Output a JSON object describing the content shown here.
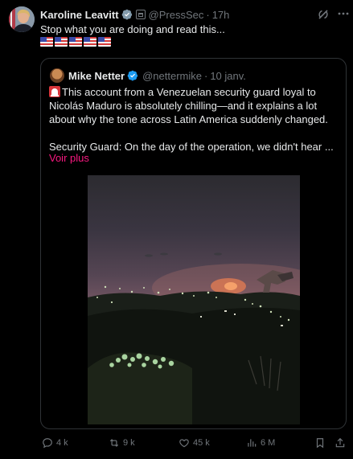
{
  "post": {
    "author_name": "Karoline Leavitt",
    "handle": "@PressSec",
    "separator": "·",
    "time": "17h",
    "text": "Stop what you are doing and read this...",
    "flags_count": 5
  },
  "quoted_post": {
    "author_name": "Mike Netter",
    "handle": "@nettermike",
    "separator": "·",
    "time": "10 janv.",
    "line1": "This account from a Venezuelan security guard loyal to",
    "line2": "Nicolás Maduro is absolutely chilling—and it explains a lot",
    "line3": "about why the tone across Latin America suddenly changed.",
    "line4": "Security Guard: On the day of the operation, we didn't hear ...",
    "see_more": "Voir plus"
  },
  "actions": {
    "replies": "4 k",
    "reposts": "9 k",
    "likes": "45 k",
    "views": "6 M"
  },
  "colors": {
    "background": "#000000",
    "text": "#e7e9ea",
    "secondary": "#71767b",
    "verified_blue": "#1d9bf0",
    "link_pink": "#f91880",
    "border": "#2f3336"
  },
  "icons": [
    "verified-icon",
    "government-badge-icon",
    "grok-icon",
    "more-icon",
    "siren-icon",
    "reply-icon",
    "repost-icon",
    "like-icon",
    "views-icon",
    "bookmark-icon",
    "share-icon"
  ]
}
